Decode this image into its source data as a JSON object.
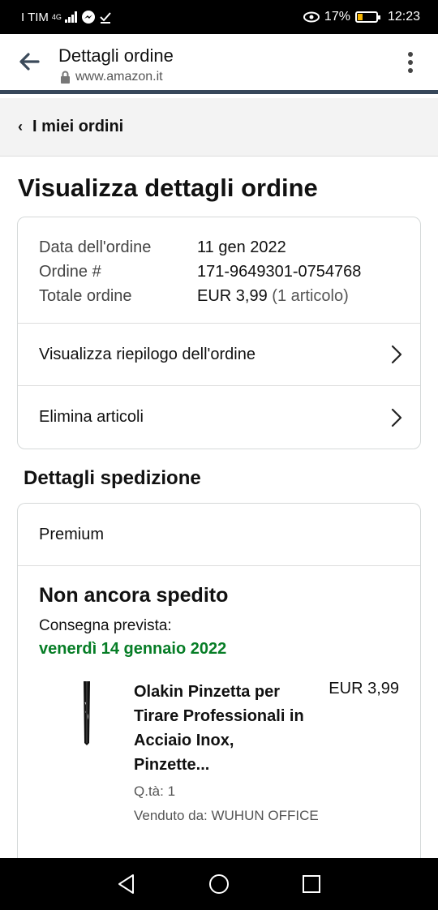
{
  "status_bar": {
    "carrier": "I TIM",
    "network": "4G",
    "battery_percent": "17%",
    "time": "12:23"
  },
  "browser": {
    "title": "Dettagli ordine",
    "url": "www.amazon.it"
  },
  "breadcrumb": {
    "label": "I miei ordini"
  },
  "page": {
    "title": "Visualizza dettagli ordine"
  },
  "order": {
    "date_label": "Data dell'ordine",
    "date_value": "11 gen 2022",
    "number_label": "Ordine #",
    "number_value": "171-9649301-0754768",
    "total_label": "Totale ordine",
    "total_value": "EUR 3,99",
    "total_items": "(1 articolo)"
  },
  "actions": {
    "summary_link": "Visualizza riepilogo dell'ordine",
    "delete_link": "Elimina articoli"
  },
  "shipping": {
    "section_title": "Dettagli spedizione",
    "type": "Premium",
    "status": "Non ancora spedito",
    "delivery_label": "Consegna prevista:",
    "delivery_date": "venerdì 14 gennaio 2022"
  },
  "item": {
    "name": "Olakin Pinzetta per Tirare Professionali in Acciaio Inox, Pinzette...",
    "price": "EUR 3,99",
    "quantity": "Q.tà: 1",
    "seller": "Venduto da: WUHUN OFFICE"
  },
  "colors": {
    "delivery_green": "#067d26",
    "header_stripe": "#37475a"
  }
}
